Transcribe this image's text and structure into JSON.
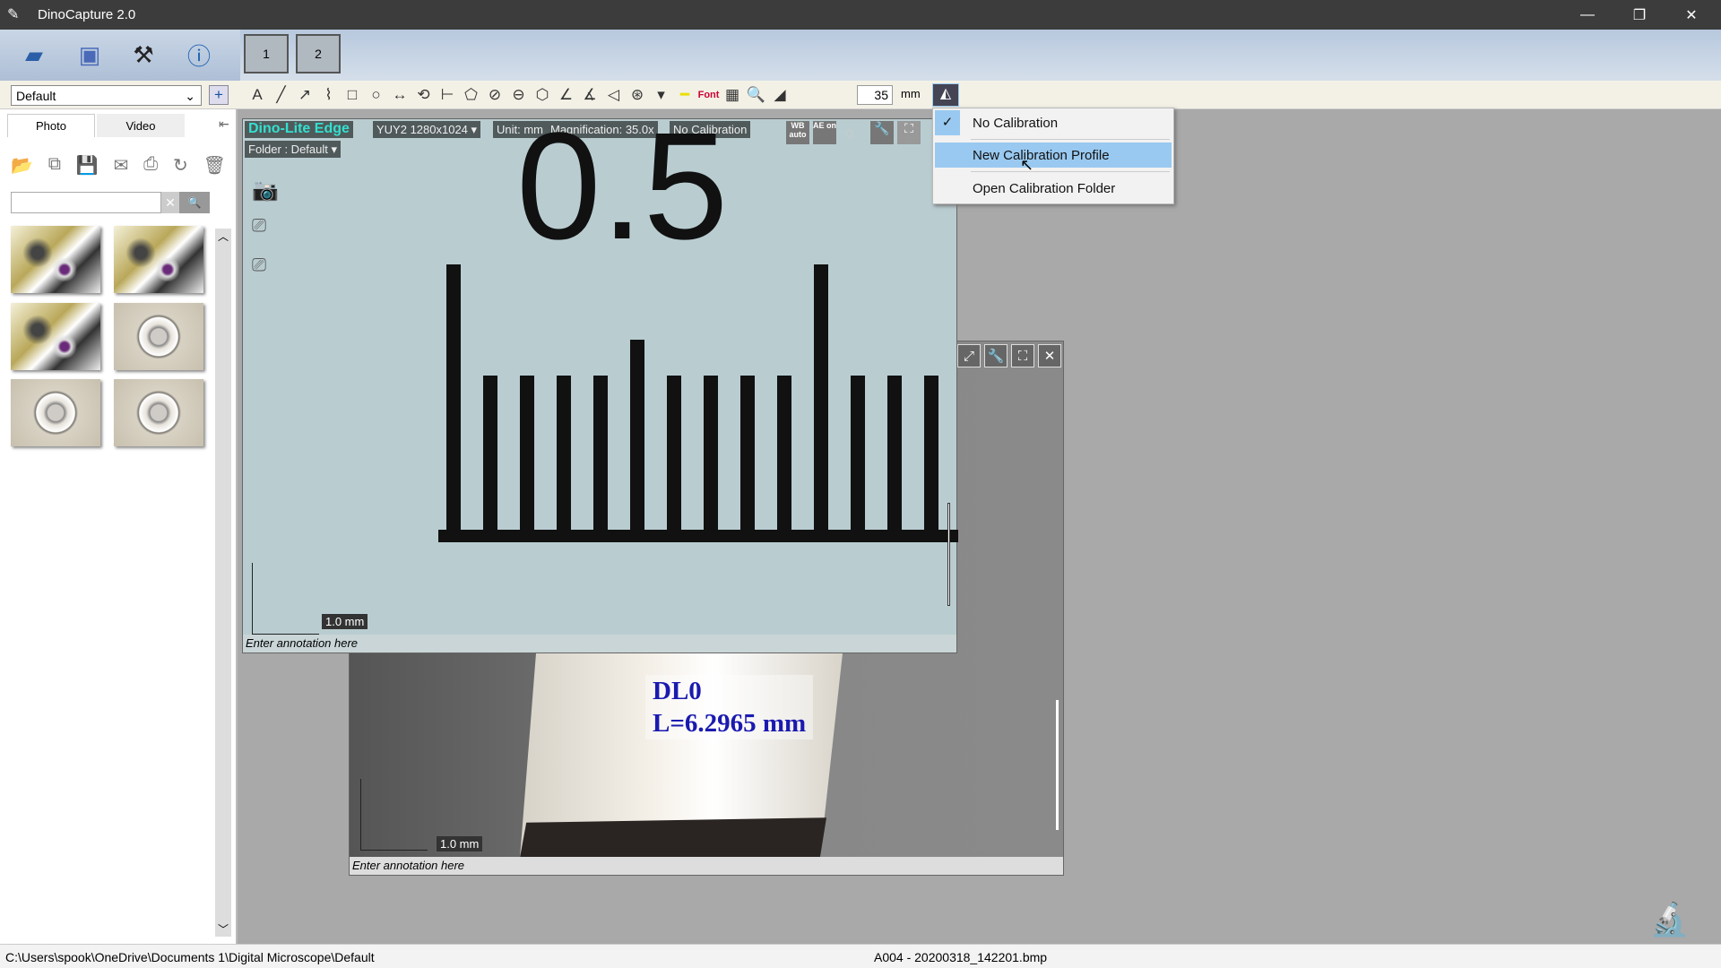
{
  "window": {
    "title": "DinoCapture 2.0",
    "minimize": "—",
    "restore": "❐",
    "close": "✕"
  },
  "ribbon": {
    "icons": [
      "folder-icon",
      "display-icon",
      "tools-icon",
      "info-icon"
    ],
    "previews": [
      "1",
      "2"
    ]
  },
  "toolbar": {
    "profile": "Default",
    "add": "+",
    "zoom_value": "35",
    "unit": "mm",
    "tools": [
      "A",
      "╱",
      "↗",
      "⌇",
      "□",
      "○",
      "↔",
      "⟲",
      "⊢",
      "⬠",
      "⊘",
      "⊖",
      "⬡",
      "∠",
      "∡",
      "◁",
      "⊛",
      "▾",
      "━",
      "Font",
      "▦",
      "🔍",
      "◢"
    ]
  },
  "leftpanel": {
    "tabs": [
      "Photo",
      "Video"
    ],
    "search_placeholder": "",
    "clear": "✕",
    "search": "🔍"
  },
  "preview1": {
    "camera": "Dino-Lite Edge",
    "format": "YUY2 1280x1024 ▾",
    "unit": "Unit: mm",
    "magnification": "Magnification:  35.0x",
    "calibration": "No Calibration",
    "folder": "Folder : Default ▾",
    "wb": "WB auto",
    "ae": "AE on",
    "ruler_label": "0.5",
    "scale": "1.0 mm",
    "annotation": "Enter annotation here"
  },
  "preview2": {
    "measure_name": "DL0",
    "measure_value": "L=6.2965 mm",
    "scale": "1.0 mm",
    "annotation": "Enter annotation here"
  },
  "calibration_menu": {
    "items": [
      {
        "label": "No Calibration",
        "checked": true
      },
      {
        "label": "New Calibration Profile",
        "highlighted": true
      },
      {
        "label": "Open Calibration Folder"
      }
    ]
  },
  "status": {
    "path": "C:\\Users\\spook\\OneDrive\\Documents 1\\Digital Microscope\\Default",
    "file": "A004 - 20200318_142201.bmp"
  },
  "colors": {
    "accent": "#99c9f0",
    "camera_label": "#33e0d0",
    "measure_text": "#1a1ab0"
  }
}
